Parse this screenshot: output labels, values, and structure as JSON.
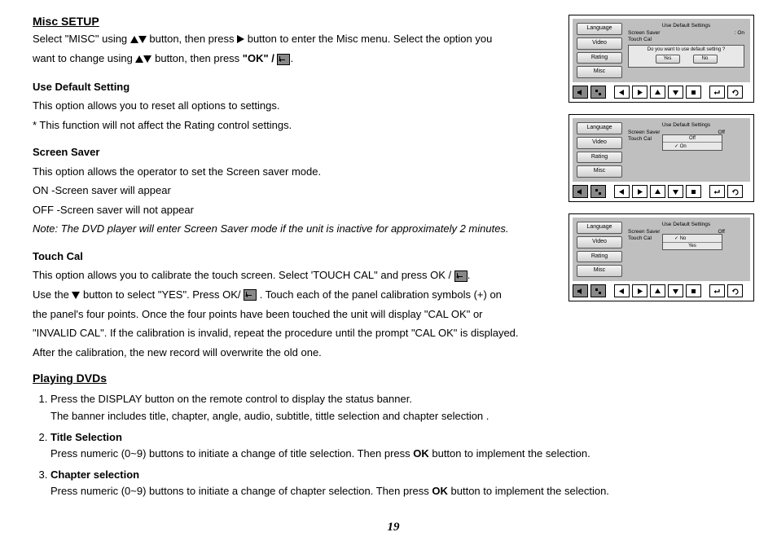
{
  "misc": {
    "title": "Misc SETUP",
    "intro_1a": "Select \"MISC\" using ",
    "intro_1b": " button, then press ",
    "intro_1c": " button to enter the Misc menu. Select the option you",
    "intro_2a": "want to change using ",
    "intro_2b": " button, then press ",
    "intro_ok": "\"OK\" / ",
    "intro_dot": ".",
    "uds_h": "Use Default Setting",
    "uds_1": "This option allows you to reset all options to settings.",
    "uds_2": "* This function will not affect the Rating control settings.",
    "ss_h": "Screen Saver",
    "ss_1": "This option allows the operator to set the Screen saver mode.",
    "ss_2": "ON -Screen saver will appear",
    "ss_3": "OFF -Screen saver will not appear",
    "ss_note": "Note: The DVD player will enter Screen Saver mode if the unit is inactive for approximately 2 minutes.",
    "tc_h": "Touch Cal",
    "tc_1a": "This option allows you to calibrate the touch screen. Select 'TOUCH CAL\" and press OK / ",
    "tc_1b": ".",
    "tc_2a": " Use the ",
    "tc_2b": " button  to select \"YES\".  Press OK/ ",
    "tc_2c": ".  Touch each of the panel calibration symbols (+) on",
    "tc_3": "the panel's four points. Once the four points have been touched the unit will display \"CAL OK\" or",
    "tc_4": "\"INVALID CAL\". If the calibration is invalid, repeat the procedure until the prompt \"CAL OK\" is displayed.",
    "tc_5": "After the calibration, the new record will overwrite the old one."
  },
  "play": {
    "title": "Playing DVDs",
    "i1a": "Press the DISPLAY button on the remote control to display the status banner.",
    "i1b": "The banner includes title, chapter, angle, audio, subtitle, tittle selection and chapter selection .",
    "i2h": "Title Selection",
    "i2a_pre": "Press numeric (0~9) buttons to initiate a change of title selection. Then press ",
    "i2a_ok": "OK",
    "i2a_post": " button to implement the selection.",
    "i3h": " Chapter selection",
    "i3a_pre": "Press numeric (0~9) buttons to initiate a change of chapter selection. Then press ",
    "i3a_ok": "OK ",
    "i3a_post": " button to implement the selection."
  },
  "tabs": {
    "language": "Language",
    "video": "Video",
    "rating": "Rating",
    "misc": "Misc"
  },
  "panel1": {
    "hdr": "Use Default Settings",
    "l1a": "Screen Saver",
    "l1b": ": On",
    "l2a": "Touch Cal",
    "prompt": "Do you want to use default setting ?",
    "yes": "Yes",
    "no": "No"
  },
  "panel2": {
    "hdr": "Use Default Settings",
    "l1a": "Screen Saver",
    "l1b": "Off",
    "l2a": "Touch Cal",
    "opt1": "Off",
    "opt2": "✓ On"
  },
  "panel3": {
    "hdr": "Use Default Settings",
    "l1a": "Screen Saver",
    "l1b": "Off",
    "l2a": "Touch Cal",
    "opt1": "✓  No",
    "opt2": "Yes"
  },
  "page": "19"
}
